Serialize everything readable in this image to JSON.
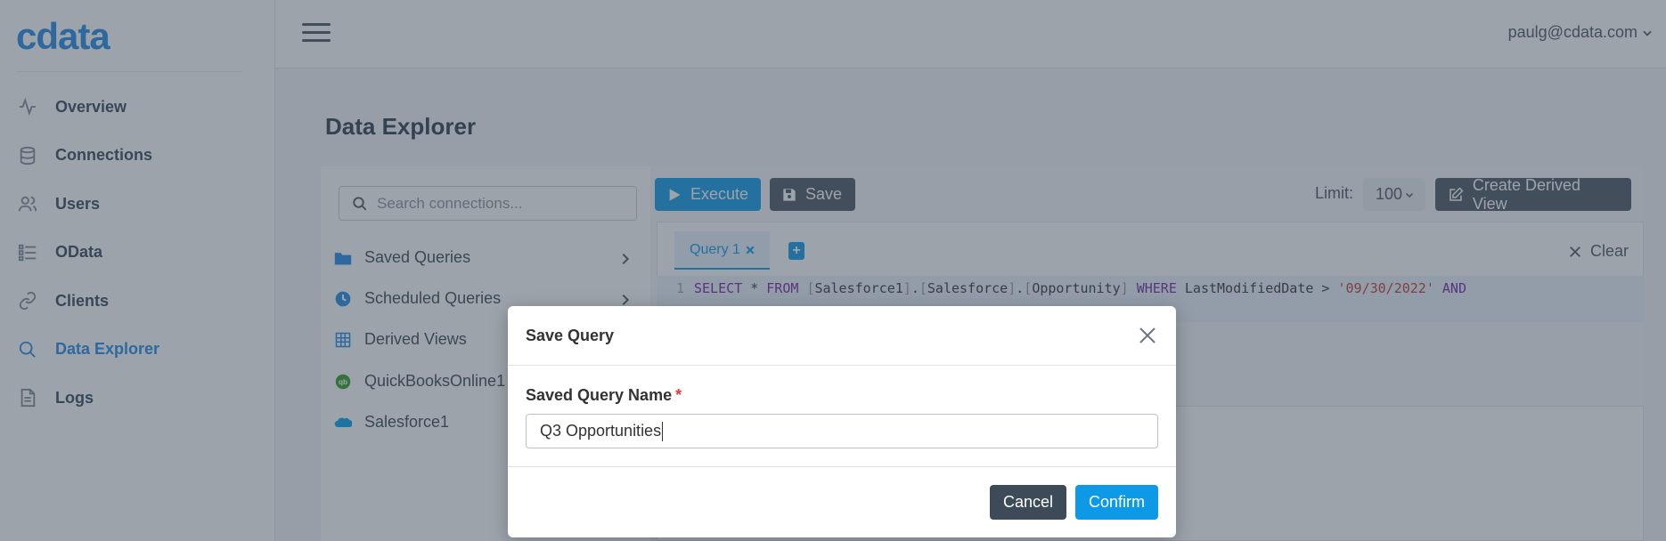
{
  "brand": {
    "logo_text": "cdata"
  },
  "sidebar": {
    "items": [
      {
        "label": "Overview",
        "icon": "activity-icon"
      },
      {
        "label": "Connections",
        "icon": "database-icon"
      },
      {
        "label": "Users",
        "icon": "users-icon"
      },
      {
        "label": "OData",
        "icon": "list-icon"
      },
      {
        "label": "Clients",
        "icon": "link-icon"
      },
      {
        "label": "Data Explorer",
        "icon": "search-icon",
        "active": true
      },
      {
        "label": "Logs",
        "icon": "document-icon"
      }
    ]
  },
  "header": {
    "user": "paulg@cdata.com"
  },
  "page": {
    "title": "Data Explorer"
  },
  "explorer": {
    "search_placeholder": "Search connections...",
    "tree": [
      {
        "label": "Saved Queries",
        "icon": "folder-icon",
        "expandable": true
      },
      {
        "label": "Scheduled Queries",
        "icon": "clock-icon",
        "expandable": true
      },
      {
        "label": "Derived Views",
        "icon": "grid-icon"
      },
      {
        "label": "QuickBooksOnline1",
        "icon": "quickbooks-icon"
      },
      {
        "label": "Salesforce1",
        "icon": "salesforce-icon"
      }
    ],
    "toolbar": {
      "execute": "Execute",
      "save": "Save",
      "limit_label": "Limit:",
      "limit_value": "100",
      "create_derived": "Create Derived View"
    },
    "tabs": {
      "query_tab": "Query 1",
      "add": "+",
      "clear": "Clear"
    },
    "editor": {
      "line_number": "1"
    }
  },
  "modal": {
    "title": "Save Query",
    "field_label": "Saved Query Name",
    "required_mark": "*",
    "field_value": "Q3 Opportunities",
    "cancel": "Cancel",
    "confirm": "Confirm"
  },
  "colors": {
    "accent": "#0d99e6",
    "dark_button": "#4a5561",
    "active_nav": "#1e88e5",
    "required": "#e53935"
  }
}
